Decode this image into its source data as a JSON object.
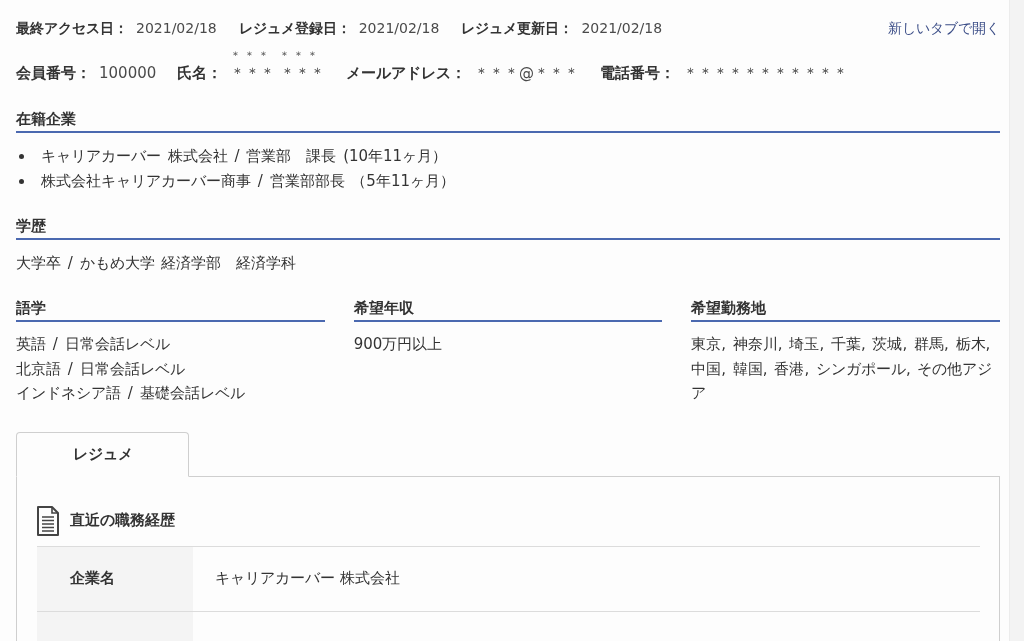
{
  "meta_dates": [
    {
      "label": "最終アクセス日：",
      "value": "2021/02/18"
    },
    {
      "label": "レジュメ登録日：",
      "value": "2021/02/18"
    },
    {
      "label": "レジュメ更新日：",
      "value": "2021/02/18"
    }
  ],
  "open_in_new_tab_link": "新しいタブで開く",
  "member_fields": [
    {
      "kind": "plain",
      "label": "会員番号：",
      "value": "100000"
    },
    {
      "kind": "ruby",
      "label": "氏名：",
      "reading": "＊＊＊ ＊＊＊",
      "value": "＊＊＊ ＊＊＊"
    },
    {
      "kind": "plain",
      "label": "メールアドレス：",
      "value": "＊＊＊@＊＊＊"
    },
    {
      "kind": "plain",
      "label": "電話番号：",
      "value": "＊＊＊＊＊＊＊＊＊＊＊"
    }
  ],
  "sections": [
    {
      "title": "在籍企業",
      "kind": "bullets",
      "items": [
        "キャリアカーバー 株式会社 / 営業部　課長 (10年11ヶ月）",
        "株式会社キャリアカーバー商事 / 営業部部長 （5年11ヶ月）"
      ]
    },
    {
      "title": "学歴",
      "kind": "text",
      "items": [
        "大学卒 / かもめ大学 経済学部　経済学科"
      ]
    }
  ],
  "columns": [
    {
      "title": "語学",
      "items": [
        "英語 / 日常会話レベル",
        "北京語 / 日常会話レベル",
        "インドネシア語 / 基礎会話レベル"
      ]
    },
    {
      "title": "希望年収",
      "items": [
        "900万円以上"
      ]
    },
    {
      "title": "希望勤務地",
      "items": [
        "東京, 神奈川, 埼玉, 千葉, 茨城, 群馬, 栃木, 中国, 韓国, 香港, シンガポール, その他アジア"
      ]
    }
  ],
  "tabs": [
    {
      "label": "レジュメ",
      "selected": true
    }
  ],
  "resume": {
    "heading": "直近の職務経歴",
    "rows": [
      {
        "label": "企業名",
        "value": "キャリアカーバー 株式会社"
      }
    ]
  }
}
